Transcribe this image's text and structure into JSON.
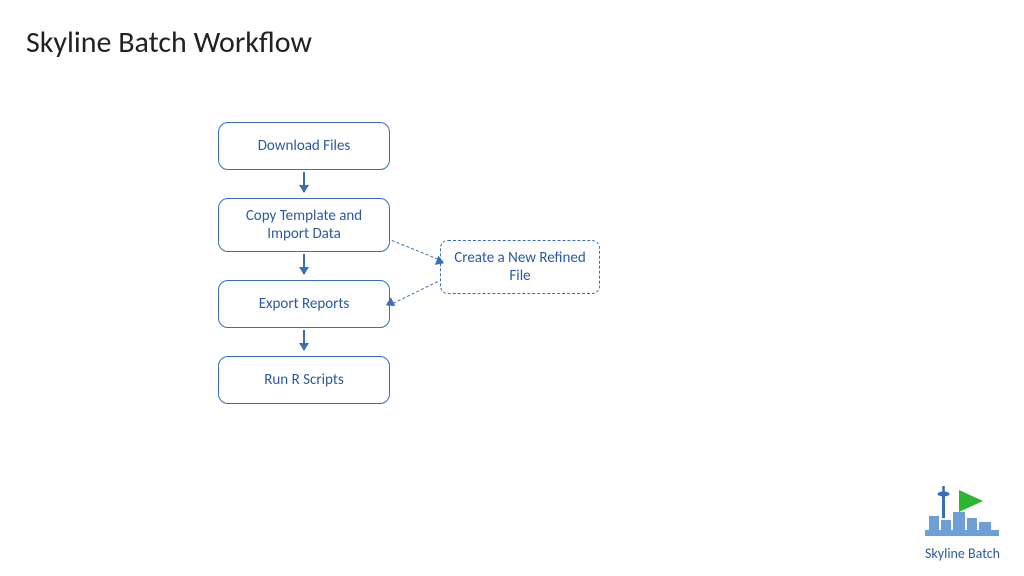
{
  "title": "Skyline Batch Workflow",
  "boxes": {
    "download": "Download Files",
    "copy": "Copy Template and Import Data",
    "export": "Export Reports",
    "run": "Run R Scripts",
    "refined": "Create a New Refined File"
  },
  "logo_label": "Skyline Batch"
}
